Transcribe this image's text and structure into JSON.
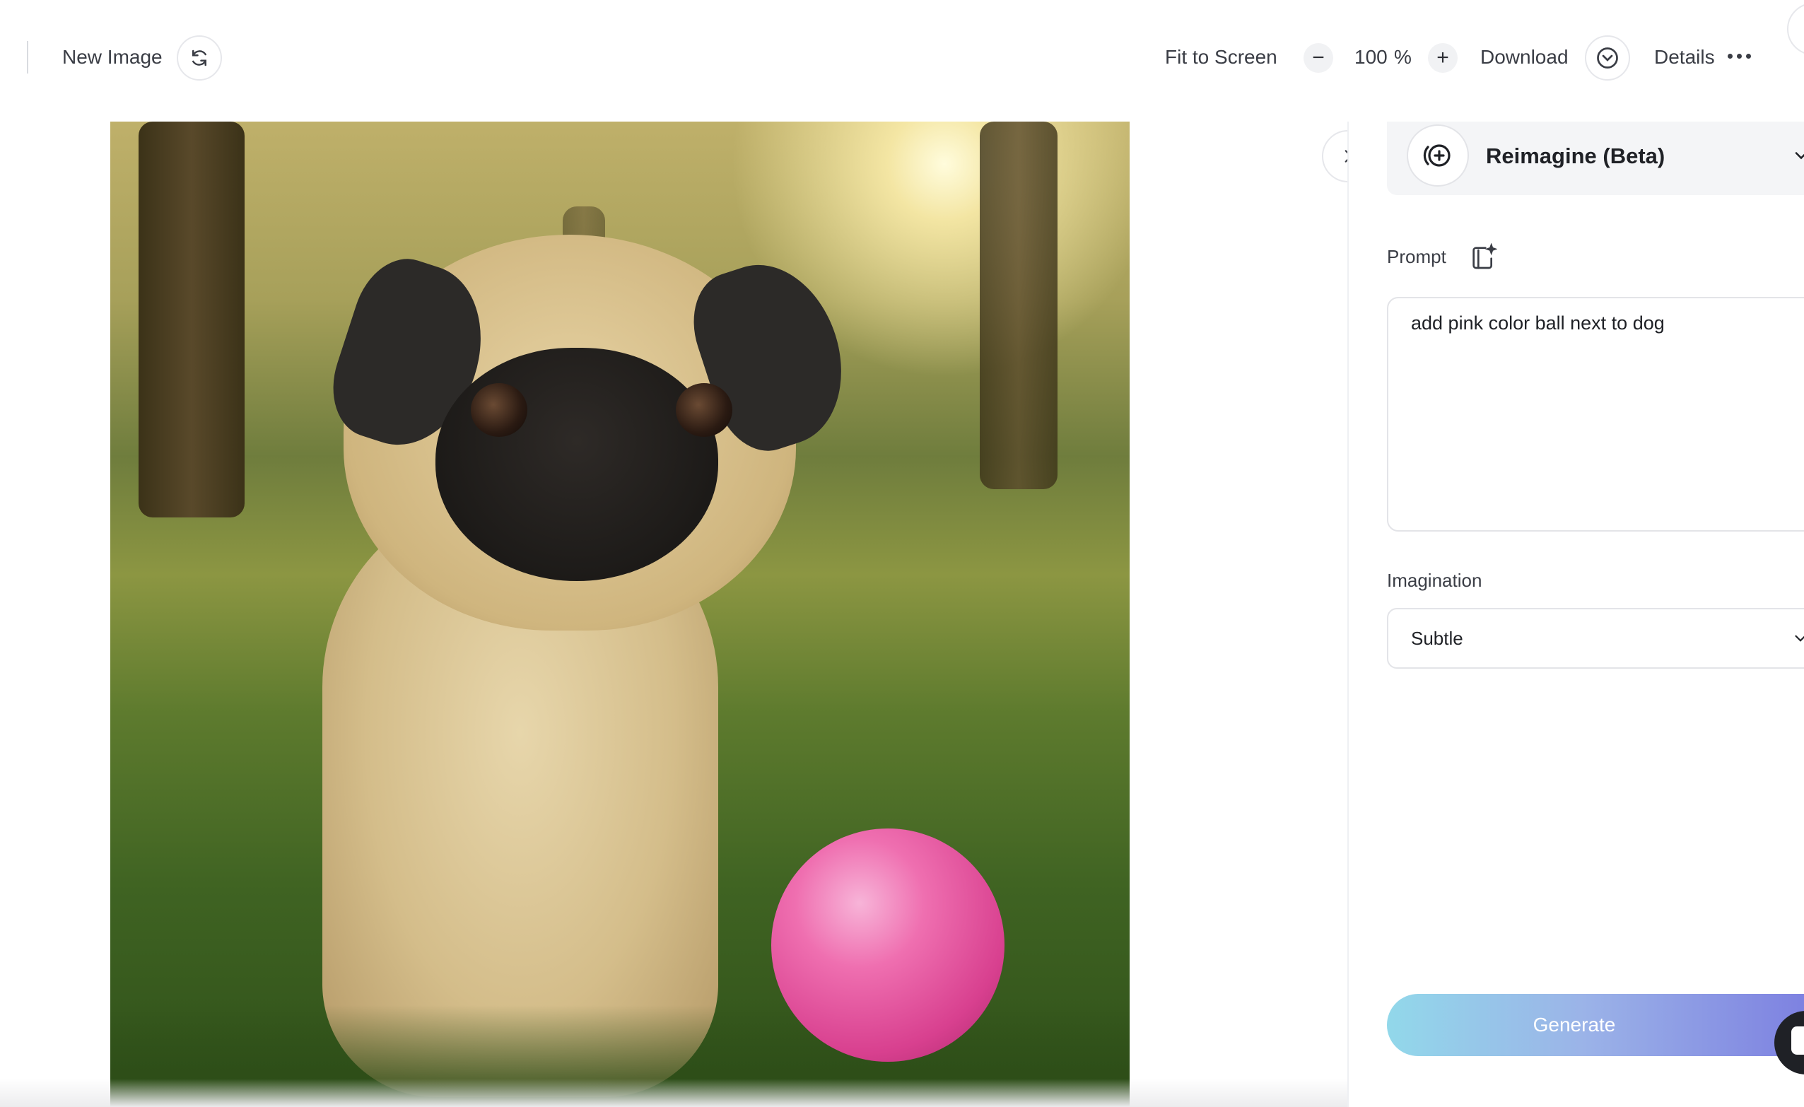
{
  "toolbar": {
    "new_image_label": "New Image",
    "fit_to_screen_label": "Fit to Screen",
    "zoom_value": "100",
    "zoom_unit": "%",
    "zoom_out_symbol": "−",
    "zoom_in_symbol": "+",
    "download_label": "Download",
    "details_label": "Details"
  },
  "panel": {
    "tool_title": "Reimagine (Beta)",
    "prompt_label": "Prompt",
    "prompt_value": "add pink color ball next to dog",
    "imagination_label": "Imagination",
    "imagination_value": "Subtle",
    "generate_label": "Generate"
  },
  "icons": {
    "refresh": "refresh-icon",
    "download_chevron": "chevron-down-circle-icon",
    "more": "more-dots-icon",
    "panel_toggle": "chevron-right-icon",
    "tool": "reimagine-plus-icon",
    "prompt_magic": "magic-prompt-icon",
    "chat": "chat-icon"
  },
  "colors": {
    "accent_gradient_start": "#92d8ea",
    "accent_gradient_end": "#7b7de0",
    "ball": "#e35aa0"
  }
}
